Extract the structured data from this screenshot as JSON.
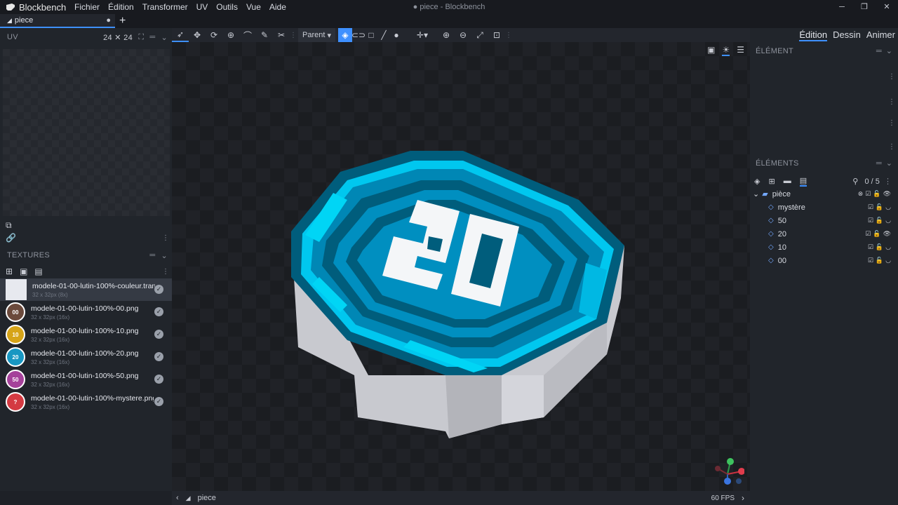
{
  "titlebar": {
    "app_name": "Blockbench",
    "window_title": "● piece - Blockbench",
    "menu": [
      "Fichier",
      "Édition",
      "Transformer",
      "UV",
      "Outils",
      "Vue",
      "Aide"
    ]
  },
  "project_tab": {
    "name": "piece"
  },
  "uv_panel": {
    "title": "UV",
    "size": "24 ✕ 24"
  },
  "textures_panel": {
    "title": "TEXTURES",
    "items": [
      {
        "name": "modele-01-00-lutin-100%-couleur.tranc",
        "dims": "32 x 32px (8x)",
        "thumb": "",
        "color": "#e7e9ef"
      },
      {
        "name": "modele-01-00-lutin-100%-00.png",
        "dims": "32 x 32px (16x)",
        "thumb": "00",
        "color": "#6b4a3c"
      },
      {
        "name": "modele-01-00-lutin-100%-10.png",
        "dims": "32 x 32px (16x)",
        "thumb": "10",
        "color": "#d6a418"
      },
      {
        "name": "modele-01-00-lutin-100%-20.png",
        "dims": "32 x 32px (16x)",
        "thumb": "20",
        "color": "#1897c2"
      },
      {
        "name": "modele-01-00-lutin-100%-50.png",
        "dims": "32 x 32px (16x)",
        "thumb": "50",
        "color": "#a5419a"
      },
      {
        "name": "modele-01-00-lutin-100%-mystere.png",
        "dims": "32 x 32px (16x)",
        "thumb": "?",
        "color": "#d43a42"
      }
    ]
  },
  "toolbar": {
    "parent_label": "Parent"
  },
  "modes": {
    "edit": "Édition",
    "paint": "Dessin",
    "animate": "Animer"
  },
  "element_panel": {
    "title": "ÉLÉMENT"
  },
  "elements_panel": {
    "title": "ÉLÉMENTS",
    "count": "0 / 5",
    "group": "pièce",
    "children": [
      "mystère",
      "50",
      "20",
      "10",
      "00"
    ]
  },
  "statusbar": {
    "project": "piece",
    "fps": "60 FPS"
  },
  "colors": {
    "accent": "#3e90ff",
    "coin_dark": "#005d7c",
    "coin_mid": "#008fc0",
    "coin_light": "#00c7ef",
    "coin_side": "#c8c9cf"
  }
}
